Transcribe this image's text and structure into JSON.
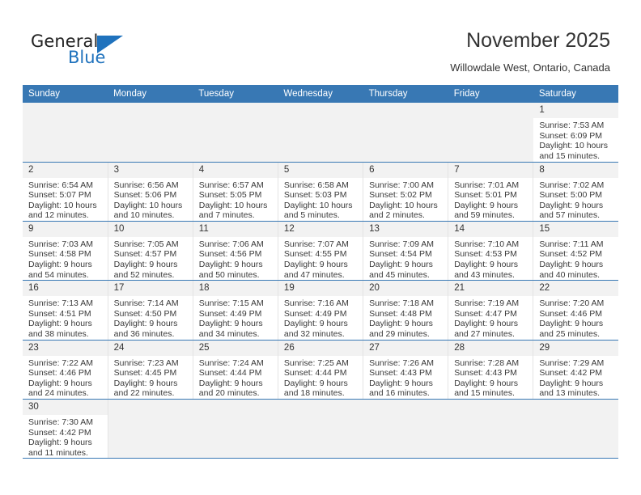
{
  "brand": {
    "name_top": "General",
    "name_bottom": "Blue",
    "triangle_color": "#1f72bd"
  },
  "header": {
    "title": "November 2025",
    "location": "Willowdale West, Ontario, Canada"
  },
  "theme": {
    "header_blue": "#3878b4",
    "daynum_bg": "#f2f2f2",
    "empty_bg": "#f2f2f2",
    "text": "#333333"
  },
  "weekdays": [
    "Sunday",
    "Monday",
    "Tuesday",
    "Wednesday",
    "Thursday",
    "Friday",
    "Saturday"
  ],
  "weeks": [
    [
      {
        "empty": true
      },
      {
        "empty": true
      },
      {
        "empty": true
      },
      {
        "empty": true
      },
      {
        "empty": true
      },
      {
        "empty": true
      },
      {
        "day": "1",
        "sunrise": "Sunrise: 7:53 AM",
        "sunset": "Sunset: 6:09 PM",
        "daylight1": "Daylight: 10 hours",
        "daylight2": "and 15 minutes."
      }
    ],
    [
      {
        "day": "2",
        "sunrise": "Sunrise: 6:54 AM",
        "sunset": "Sunset: 5:07 PM",
        "daylight1": "Daylight: 10 hours",
        "daylight2": "and 12 minutes."
      },
      {
        "day": "3",
        "sunrise": "Sunrise: 6:56 AM",
        "sunset": "Sunset: 5:06 PM",
        "daylight1": "Daylight: 10 hours",
        "daylight2": "and 10 minutes."
      },
      {
        "day": "4",
        "sunrise": "Sunrise: 6:57 AM",
        "sunset": "Sunset: 5:05 PM",
        "daylight1": "Daylight: 10 hours",
        "daylight2": "and 7 minutes."
      },
      {
        "day": "5",
        "sunrise": "Sunrise: 6:58 AM",
        "sunset": "Sunset: 5:03 PM",
        "daylight1": "Daylight: 10 hours",
        "daylight2": "and 5 minutes."
      },
      {
        "day": "6",
        "sunrise": "Sunrise: 7:00 AM",
        "sunset": "Sunset: 5:02 PM",
        "daylight1": "Daylight: 10 hours",
        "daylight2": "and 2 minutes."
      },
      {
        "day": "7",
        "sunrise": "Sunrise: 7:01 AM",
        "sunset": "Sunset: 5:01 PM",
        "daylight1": "Daylight: 9 hours",
        "daylight2": "and 59 minutes."
      },
      {
        "day": "8",
        "sunrise": "Sunrise: 7:02 AM",
        "sunset": "Sunset: 5:00 PM",
        "daylight1": "Daylight: 9 hours",
        "daylight2": "and 57 minutes."
      }
    ],
    [
      {
        "day": "9",
        "sunrise": "Sunrise: 7:03 AM",
        "sunset": "Sunset: 4:58 PM",
        "daylight1": "Daylight: 9 hours",
        "daylight2": "and 54 minutes."
      },
      {
        "day": "10",
        "sunrise": "Sunrise: 7:05 AM",
        "sunset": "Sunset: 4:57 PM",
        "daylight1": "Daylight: 9 hours",
        "daylight2": "and 52 minutes."
      },
      {
        "day": "11",
        "sunrise": "Sunrise: 7:06 AM",
        "sunset": "Sunset: 4:56 PM",
        "daylight1": "Daylight: 9 hours",
        "daylight2": "and 50 minutes."
      },
      {
        "day": "12",
        "sunrise": "Sunrise: 7:07 AM",
        "sunset": "Sunset: 4:55 PM",
        "daylight1": "Daylight: 9 hours",
        "daylight2": "and 47 minutes."
      },
      {
        "day": "13",
        "sunrise": "Sunrise: 7:09 AM",
        "sunset": "Sunset: 4:54 PM",
        "daylight1": "Daylight: 9 hours",
        "daylight2": "and 45 minutes."
      },
      {
        "day": "14",
        "sunrise": "Sunrise: 7:10 AM",
        "sunset": "Sunset: 4:53 PM",
        "daylight1": "Daylight: 9 hours",
        "daylight2": "and 43 minutes."
      },
      {
        "day": "15",
        "sunrise": "Sunrise: 7:11 AM",
        "sunset": "Sunset: 4:52 PM",
        "daylight1": "Daylight: 9 hours",
        "daylight2": "and 40 minutes."
      }
    ],
    [
      {
        "day": "16",
        "sunrise": "Sunrise: 7:13 AM",
        "sunset": "Sunset: 4:51 PM",
        "daylight1": "Daylight: 9 hours",
        "daylight2": "and 38 minutes."
      },
      {
        "day": "17",
        "sunrise": "Sunrise: 7:14 AM",
        "sunset": "Sunset: 4:50 PM",
        "daylight1": "Daylight: 9 hours",
        "daylight2": "and 36 minutes."
      },
      {
        "day": "18",
        "sunrise": "Sunrise: 7:15 AM",
        "sunset": "Sunset: 4:49 PM",
        "daylight1": "Daylight: 9 hours",
        "daylight2": "and 34 minutes."
      },
      {
        "day": "19",
        "sunrise": "Sunrise: 7:16 AM",
        "sunset": "Sunset: 4:49 PM",
        "daylight1": "Daylight: 9 hours",
        "daylight2": "and 32 minutes."
      },
      {
        "day": "20",
        "sunrise": "Sunrise: 7:18 AM",
        "sunset": "Sunset: 4:48 PM",
        "daylight1": "Daylight: 9 hours",
        "daylight2": "and 29 minutes."
      },
      {
        "day": "21",
        "sunrise": "Sunrise: 7:19 AM",
        "sunset": "Sunset: 4:47 PM",
        "daylight1": "Daylight: 9 hours",
        "daylight2": "and 27 minutes."
      },
      {
        "day": "22",
        "sunrise": "Sunrise: 7:20 AM",
        "sunset": "Sunset: 4:46 PM",
        "daylight1": "Daylight: 9 hours",
        "daylight2": "and 25 minutes."
      }
    ],
    [
      {
        "day": "23",
        "sunrise": "Sunrise: 7:22 AM",
        "sunset": "Sunset: 4:46 PM",
        "daylight1": "Daylight: 9 hours",
        "daylight2": "and 24 minutes."
      },
      {
        "day": "24",
        "sunrise": "Sunrise: 7:23 AM",
        "sunset": "Sunset: 4:45 PM",
        "daylight1": "Daylight: 9 hours",
        "daylight2": "and 22 minutes."
      },
      {
        "day": "25",
        "sunrise": "Sunrise: 7:24 AM",
        "sunset": "Sunset: 4:44 PM",
        "daylight1": "Daylight: 9 hours",
        "daylight2": "and 20 minutes."
      },
      {
        "day": "26",
        "sunrise": "Sunrise: 7:25 AM",
        "sunset": "Sunset: 4:44 PM",
        "daylight1": "Daylight: 9 hours",
        "daylight2": "and 18 minutes."
      },
      {
        "day": "27",
        "sunrise": "Sunrise: 7:26 AM",
        "sunset": "Sunset: 4:43 PM",
        "daylight1": "Daylight: 9 hours",
        "daylight2": "and 16 minutes."
      },
      {
        "day": "28",
        "sunrise": "Sunrise: 7:28 AM",
        "sunset": "Sunset: 4:43 PM",
        "daylight1": "Daylight: 9 hours",
        "daylight2": "and 15 minutes."
      },
      {
        "day": "29",
        "sunrise": "Sunrise: 7:29 AM",
        "sunset": "Sunset: 4:42 PM",
        "daylight1": "Daylight: 9 hours",
        "daylight2": "and 13 minutes."
      }
    ],
    [
      {
        "day": "30",
        "sunrise": "Sunrise: 7:30 AM",
        "sunset": "Sunset: 4:42 PM",
        "daylight1": "Daylight: 9 hours",
        "daylight2": "and 11 minutes."
      },
      {
        "empty": true
      },
      {
        "empty": true
      },
      {
        "empty": true
      },
      {
        "empty": true
      },
      {
        "empty": true
      },
      {
        "empty": true
      }
    ]
  ]
}
